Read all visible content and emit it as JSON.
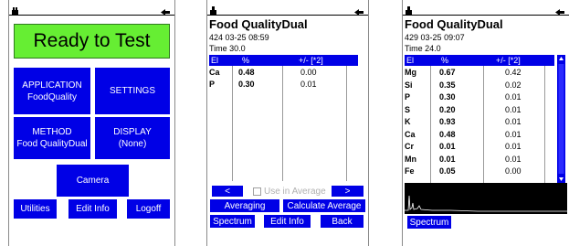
{
  "screen1": {
    "ready_label": "Ready to Test",
    "application": {
      "title": "APPLICATION",
      "value": "FoodQuality"
    },
    "settings_label": "SETTINGS",
    "method": {
      "title": "METHOD",
      "value": "Food QualityDual"
    },
    "display": {
      "title": "DISPLAY",
      "value": "(None)"
    },
    "camera_label": "Camera",
    "utilities_label": "Utilities",
    "edit_info_label": "Edit Info",
    "logoff_label": "Logoff",
    "colors": {
      "ready_bg": "#66ee33",
      "button_bg": "#0000e6"
    }
  },
  "screen2": {
    "title": "Food QualityDual",
    "test_number": "424",
    "datetime": "03-25 08:59",
    "time_label": "Time 30.0",
    "columns": [
      "El",
      "%",
      "+/- [*2]"
    ],
    "rows": [
      {
        "el": "Ca",
        "pct": "0.48",
        "err": "0.00"
      },
      {
        "el": "P",
        "pct": "0.30",
        "err": "0.01"
      }
    ],
    "prev_label": "<",
    "next_label": ">",
    "use_in_average_label": "Use in Average",
    "averaging_label": "Averaging",
    "calculate_average_label": "Calculate Average",
    "spectrum_label": "Spectrum",
    "edit_info_label": "Edit Info",
    "back_label": "Back"
  },
  "screen3": {
    "title": "Food QualityDual",
    "test_number": "429",
    "datetime": "03-25 09:07",
    "time_label": "Time 24.0",
    "columns": [
      "El",
      "%",
      "+/- [*2]"
    ],
    "rows": [
      {
        "el": "Mg",
        "pct": "0.67",
        "err": "0.42"
      },
      {
        "el": "Si",
        "pct": "0.35",
        "err": "0.02"
      },
      {
        "el": "P",
        "pct": "0.30",
        "err": "0.01"
      },
      {
        "el": "S",
        "pct": "0.20",
        "err": "0.01"
      },
      {
        "el": "K",
        "pct": "0.93",
        "err": "0.01"
      },
      {
        "el": "Ca",
        "pct": "0.48",
        "err": "0.01"
      },
      {
        "el": "Cr",
        "pct": "0.01",
        "err": "0.01"
      },
      {
        "el": "Mn",
        "pct": "0.01",
        "err": "0.01"
      },
      {
        "el": "Fe",
        "pct": "0.05",
        "err": "0.00"
      }
    ],
    "spectrum_label": "Spectrum"
  }
}
